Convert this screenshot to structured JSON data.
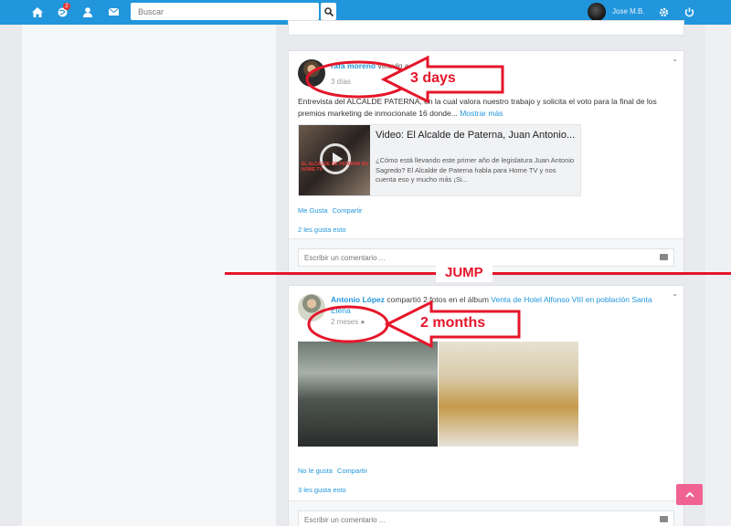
{
  "topbar": {
    "search_placeholder": "Buscar",
    "notification_count": "2",
    "user_name": "Jose M.B."
  },
  "posts": [
    {
      "author": "rafa moreno",
      "action": "vínculo a",
      "target": "video",
      "time": "3 días",
      "body": "Entrevista del ALCALDE PATERNA, en la cual valora nuestro trabajo y solicita el voto para la final de los premios marketing de inmocionate 16 donde...",
      "more": "Mostrar más",
      "video_title": "Video: El Alcalde de Paterna, Juan Antonio...",
      "video_desc": "¿Cómo está llevando este primer año de legislatura Juan Antonio Sagredo? El Alcalde de Paterna habla para Home TV y nos cuenta eso y mucho más ¡Si...",
      "thumb_text": "EL ALCALDE DE PATERNA EN HOME TV",
      "like": "Me Gusta",
      "share": "Compartir",
      "likes_count": "2 les gusta esto",
      "comment_placeholder": "Escribir un comentario ..."
    },
    {
      "author": "Antonio López",
      "action": "compartió 2 fotos en el álbum",
      "target": "Venta de Hotel Alfonso VIII en población Santa Elena",
      "time": "2 meses",
      "like": "No le gusta",
      "share": "Compartir",
      "likes_count": "3 les gusta esto",
      "comment_placeholder": "Escribir un comentario ..."
    }
  ],
  "annotations": {
    "days": "3 days",
    "months": "2 months",
    "jump": "JUMP"
  },
  "colors": {
    "topbar": "#2196dc",
    "annotation": "#e5162a",
    "link": "#2196dc"
  }
}
